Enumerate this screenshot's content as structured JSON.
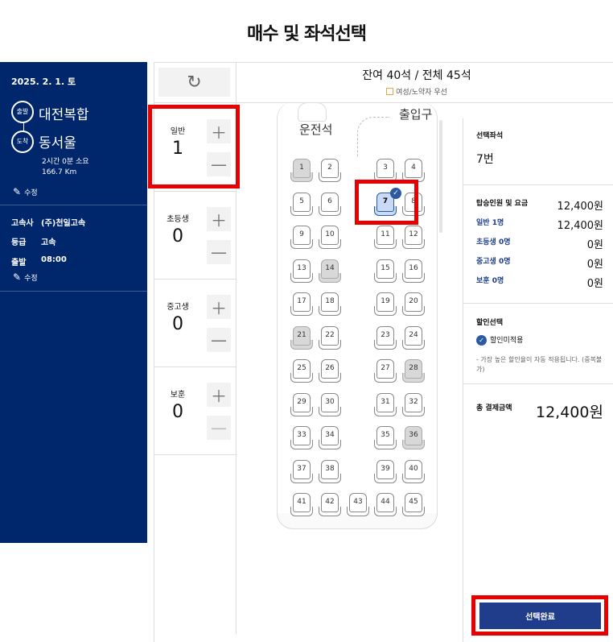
{
  "page": {
    "title": "매수 및 좌석선택"
  },
  "sidebar": {
    "date": "2025. 2. 1. 토",
    "departure_badge": "출발",
    "departure": "대전복합",
    "arrival_badge": "도착",
    "arrival": "동서울",
    "duration": "2시간 0분 소요",
    "distance": "166.7 Km",
    "edit_label_1": "수정",
    "company_label": "고속사",
    "company": "(주)천일고속",
    "grade_label": "등급",
    "grade": "고속",
    "depart_time_label": "출발",
    "depart_time": "08:00",
    "edit_label_2": "수정"
  },
  "header": {
    "seat_summary": "잔여 40석 / 전체 45석",
    "priority_note": "여성/노약자 우선"
  },
  "counters": [
    {
      "label": "일반",
      "count": "1"
    },
    {
      "label": "초등생",
      "count": "0"
    },
    {
      "label": "중고생",
      "count": "0"
    },
    {
      "label": "보훈",
      "count": "0"
    }
  ],
  "bus": {
    "driver_label": "운전석",
    "exit_label": "출입구",
    "seats": [
      {
        "n": "1",
        "state": "taken"
      },
      {
        "n": "2",
        "state": "available"
      },
      {
        "n": "3",
        "state": "available"
      },
      {
        "n": "4",
        "state": "available"
      },
      {
        "n": "5",
        "state": "available"
      },
      {
        "n": "6",
        "state": "available"
      },
      {
        "n": "7",
        "state": "selected"
      },
      {
        "n": "8",
        "state": "available"
      },
      {
        "n": "9",
        "state": "available"
      },
      {
        "n": "10",
        "state": "available"
      },
      {
        "n": "11",
        "state": "available"
      },
      {
        "n": "12",
        "state": "available"
      },
      {
        "n": "13",
        "state": "available"
      },
      {
        "n": "14",
        "state": "taken"
      },
      {
        "n": "15",
        "state": "available"
      },
      {
        "n": "16",
        "state": "available"
      },
      {
        "n": "17",
        "state": "available"
      },
      {
        "n": "18",
        "state": "available"
      },
      {
        "n": "19",
        "state": "available"
      },
      {
        "n": "20",
        "state": "available"
      },
      {
        "n": "21",
        "state": "taken"
      },
      {
        "n": "22",
        "state": "available"
      },
      {
        "n": "23",
        "state": "available"
      },
      {
        "n": "24",
        "state": "available"
      },
      {
        "n": "25",
        "state": "available"
      },
      {
        "n": "26",
        "state": "available"
      },
      {
        "n": "27",
        "state": "available"
      },
      {
        "n": "28",
        "state": "taken"
      },
      {
        "n": "29",
        "state": "available"
      },
      {
        "n": "30",
        "state": "available"
      },
      {
        "n": "31",
        "state": "available"
      },
      {
        "n": "32",
        "state": "available"
      },
      {
        "n": "33",
        "state": "available"
      },
      {
        "n": "34",
        "state": "available"
      },
      {
        "n": "35",
        "state": "available"
      },
      {
        "n": "36",
        "state": "taken"
      },
      {
        "n": "37",
        "state": "available"
      },
      {
        "n": "38",
        "state": "available"
      },
      {
        "n": "39",
        "state": "available"
      },
      {
        "n": "40",
        "state": "available"
      },
      {
        "n": "41",
        "state": "available"
      },
      {
        "n": "42",
        "state": "available"
      },
      {
        "n": "43",
        "state": "available"
      },
      {
        "n": "44",
        "state": "available"
      },
      {
        "n": "45",
        "state": "available"
      }
    ]
  },
  "summary": {
    "selected_seat_title": "선택좌석",
    "selected_seat": "7번",
    "fare_title": "탑승인원 및 요금",
    "fare_total": "12,400원",
    "rows": [
      {
        "label": "일반 1명",
        "value": "12,400원"
      },
      {
        "label": "초등생 0명",
        "value": "0원"
      },
      {
        "label": "중고생 0명",
        "value": "0원"
      },
      {
        "label": "보훈 0명",
        "value": "0원"
      }
    ],
    "discount_title": "할인선택",
    "discount_option": "할인미적용",
    "discount_note": "- 가장 높은 할인율이 자동 적용됩니다. (중복불가)",
    "total_title": "총 결제금액",
    "total": "12,400원",
    "complete_button": "선택완료"
  },
  "colors": {
    "sidebar_bg": "#00266b",
    "accent": "#1f3d8a",
    "highlight": "#e60000"
  }
}
